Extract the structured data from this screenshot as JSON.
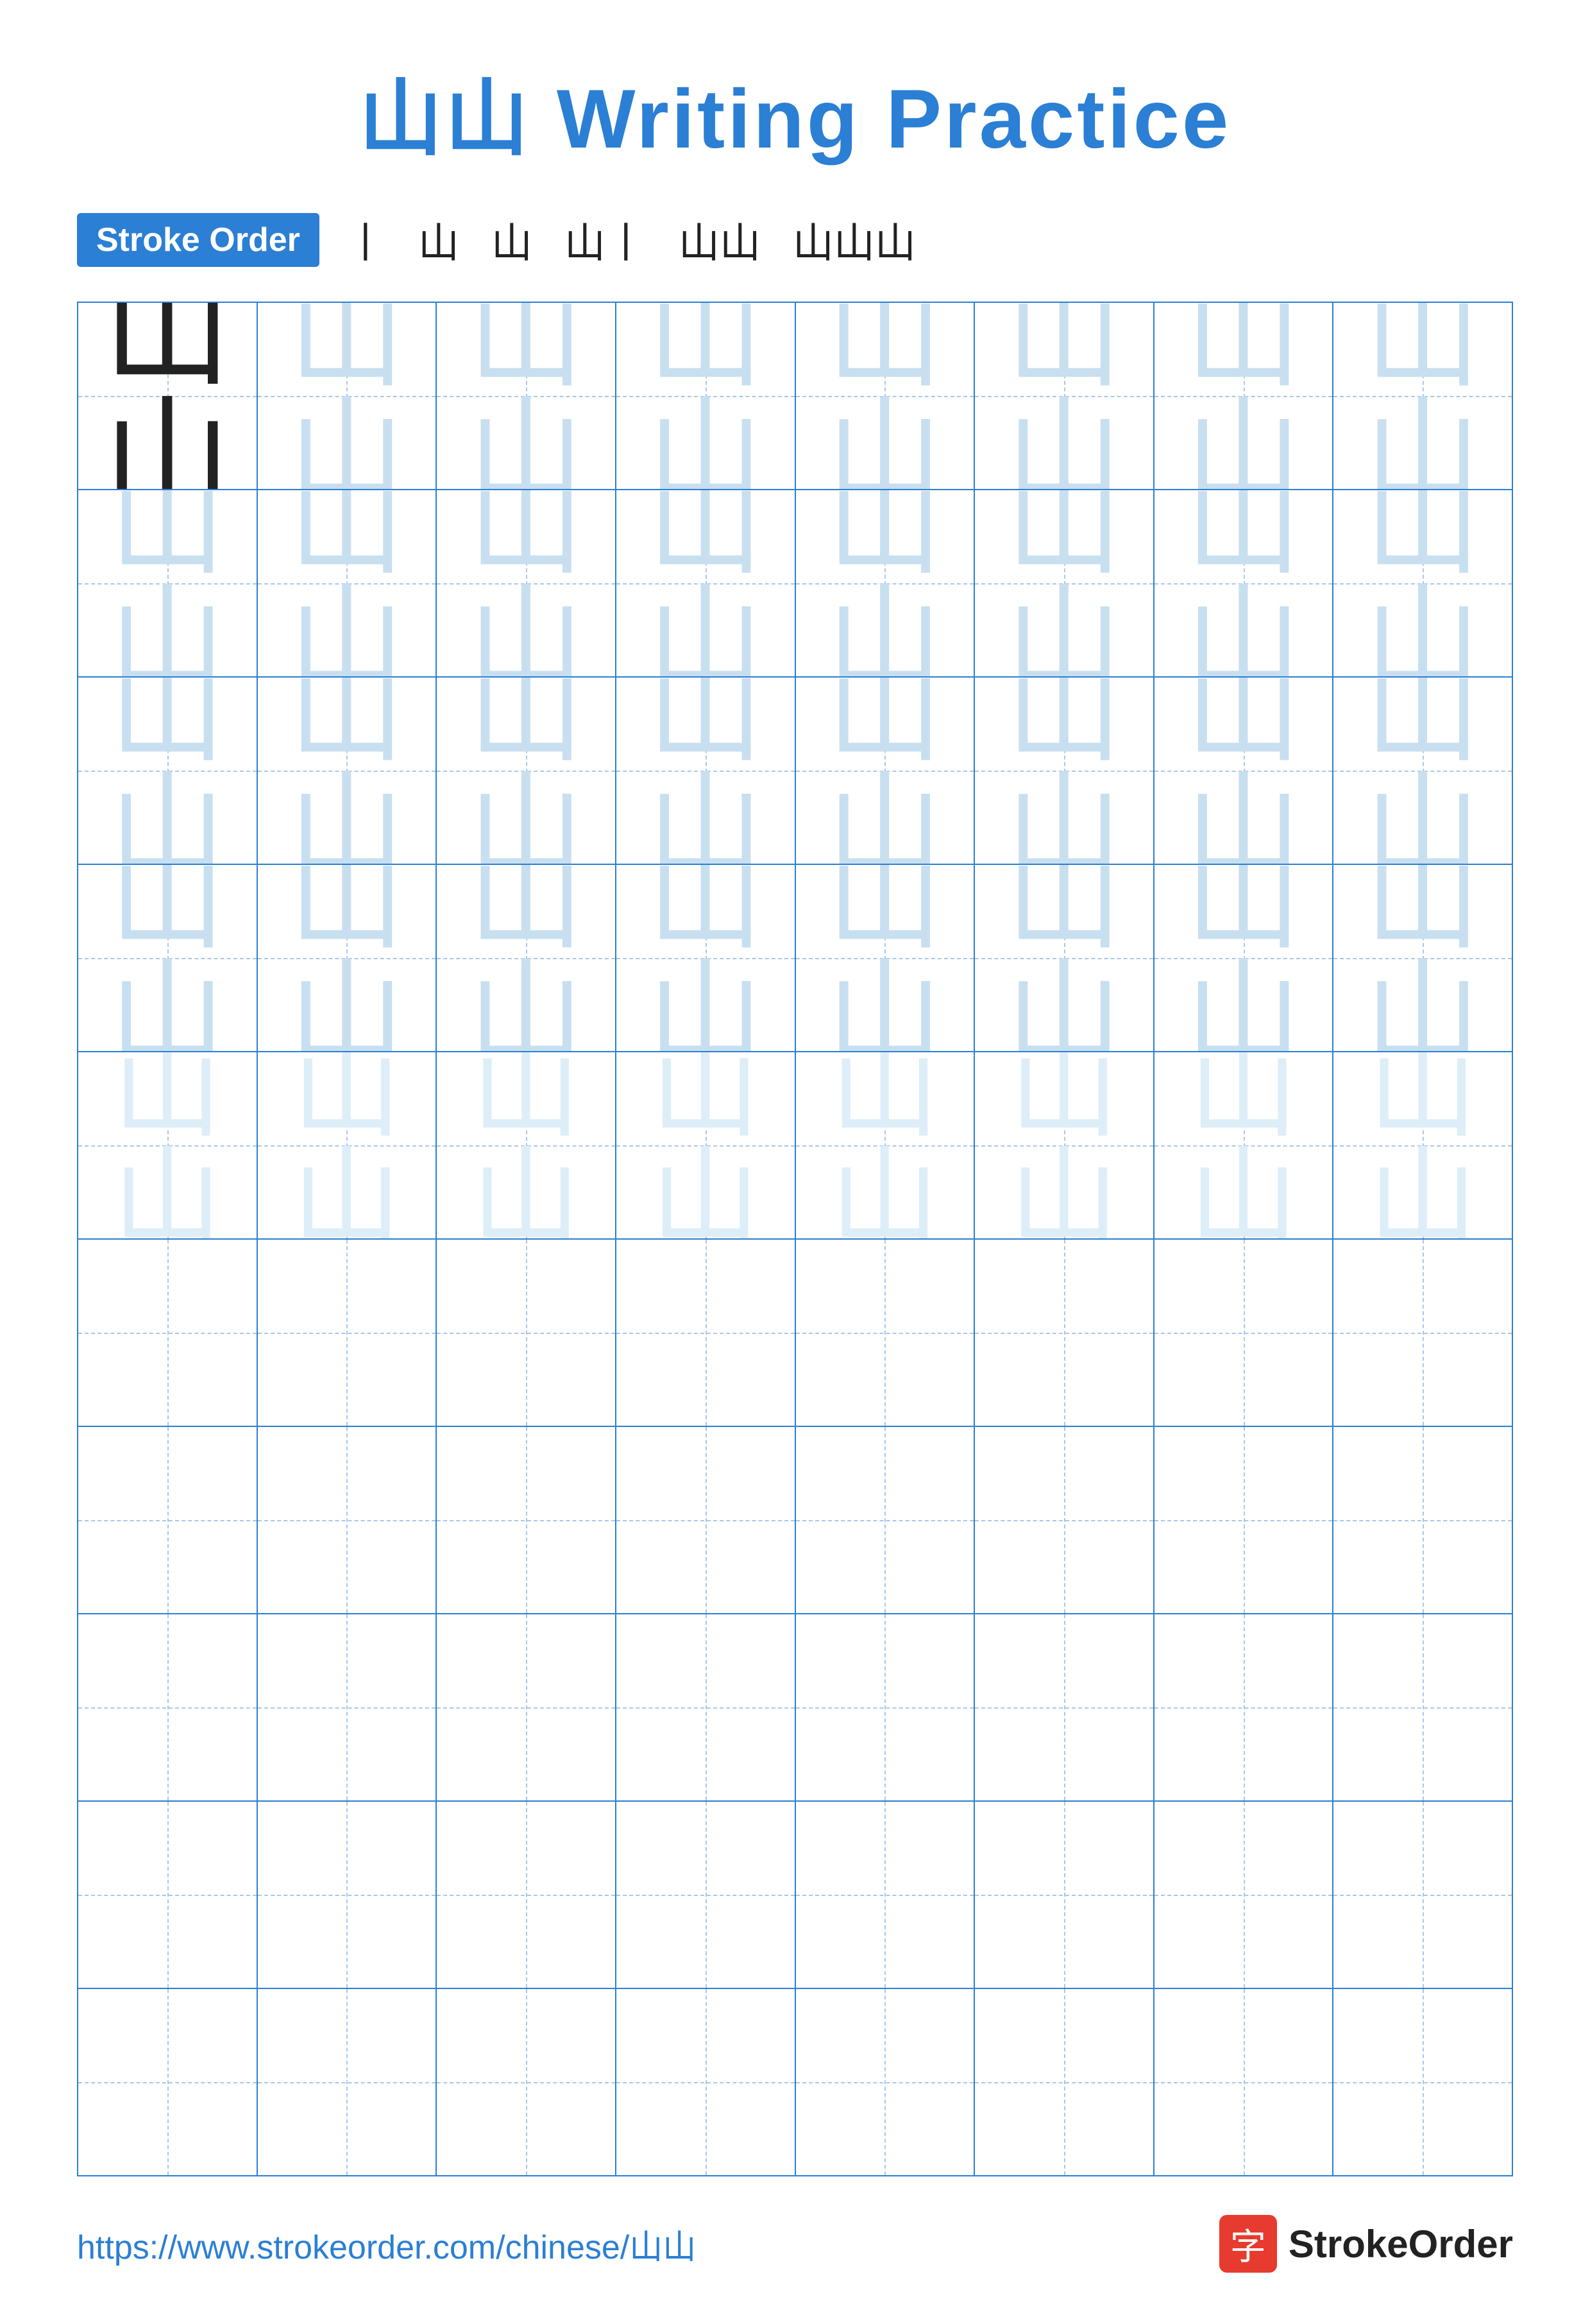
{
  "title": {
    "icon": "山山",
    "text": "Writing Practice"
  },
  "stroke_order": {
    "badge_label": "Stroke Order",
    "steps": [
      "丨",
      "山",
      "山",
      "山丨",
      "山山",
      "山山山"
    ]
  },
  "grid": {
    "rows": 10,
    "cols": 8,
    "character": "山山",
    "char_single": "山山",
    "practice_rows_dark": 1,
    "practice_rows_light": 4,
    "practice_rows_empty": 5
  },
  "footer": {
    "url": "https://www.strokeorder.com/chinese/山山",
    "brand_char": "字",
    "brand_name": "StrokeOrder"
  }
}
